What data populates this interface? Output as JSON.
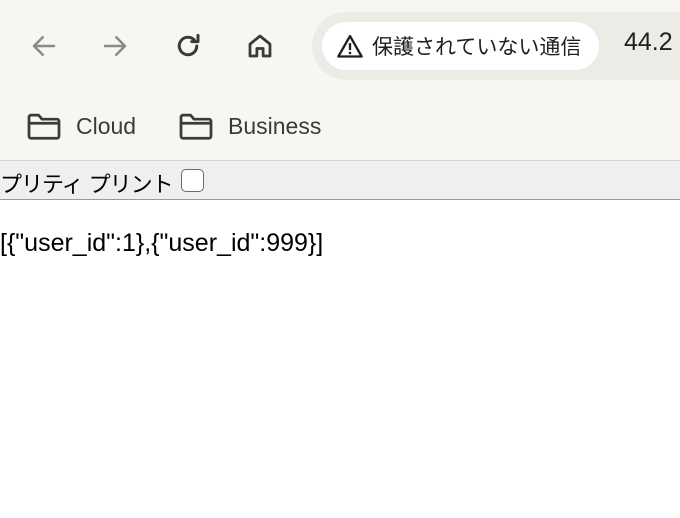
{
  "browser": {
    "nav": {
      "back_icon": "arrow-left-icon",
      "forward_icon": "arrow-right-icon",
      "reload_icon": "reload-icon",
      "home_icon": "home-icon"
    },
    "omnibox": {
      "security_icon": "warning-triangle-icon",
      "security_label": "保護されていない通信",
      "url": "44.2"
    },
    "bookmarks": [
      {
        "icon": "folder-icon",
        "label": "Cloud"
      },
      {
        "icon": "folder-icon",
        "label": "Business"
      }
    ]
  },
  "page": {
    "pretty_print_label": "プリティ プリント",
    "pretty_print_checked": false,
    "json_text": "[{\"user_id\":1},{\"user_id\":999}]"
  },
  "colors": {
    "toolbar_bg": "#f7f6f2",
    "omnibox_bg": "#ecebe6",
    "chip_bg": "#ffffff",
    "pretty_print_bar_bg": "#efefef",
    "icon_disabled": "#8a8a8a",
    "icon_active": "#3a3a3a"
  }
}
